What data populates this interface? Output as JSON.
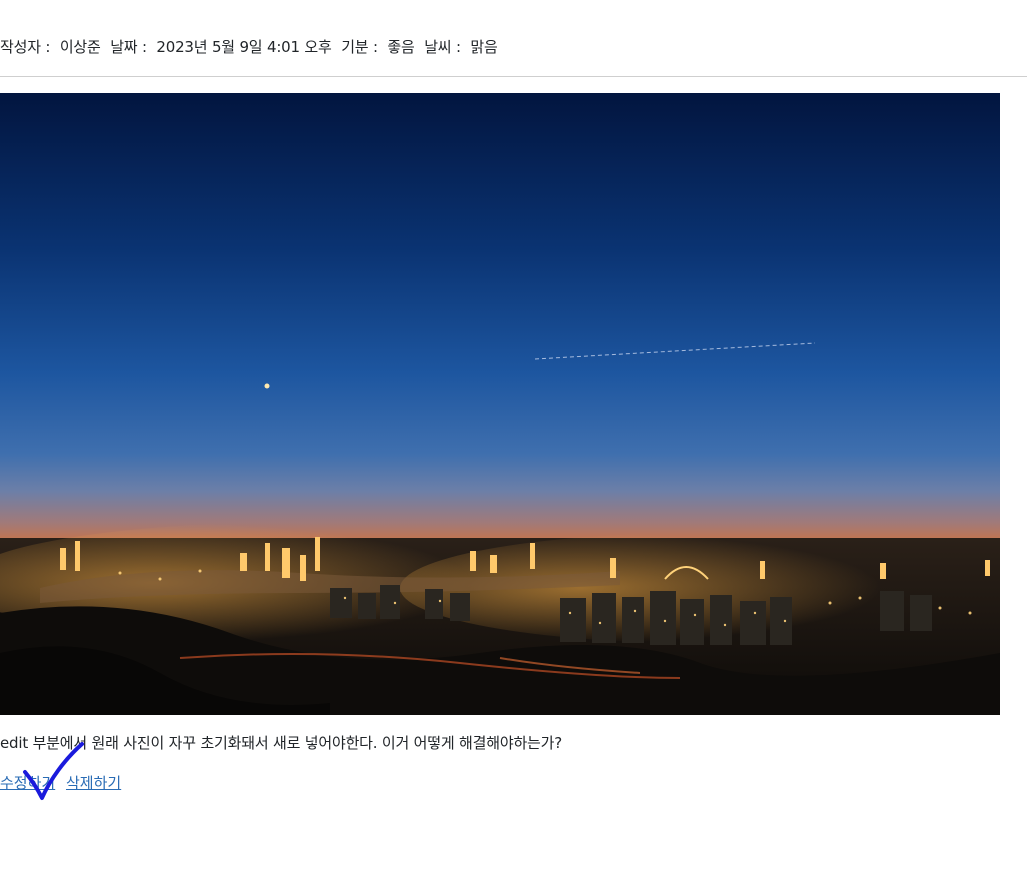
{
  "post": {
    "author_label": "작성자 :",
    "author": "이상준",
    "date_label": "날짜 :",
    "date": "2023년 5월 9일 4:01 오후",
    "mood_label": "기분 :",
    "mood": "좋음",
    "weather_label": "날씨 :",
    "weather": "맑음",
    "content": "edit 부분에서 원래 사진이 자꾸 초기화돼서 새로 넣어야한다. 이거 어떻게 해결해야하는가?"
  },
  "actions": {
    "edit_label": "수정하기",
    "delete_label": "삭제하기"
  },
  "colors": {
    "link": "#2a6cb5",
    "check_mark": "#1a1adc"
  }
}
